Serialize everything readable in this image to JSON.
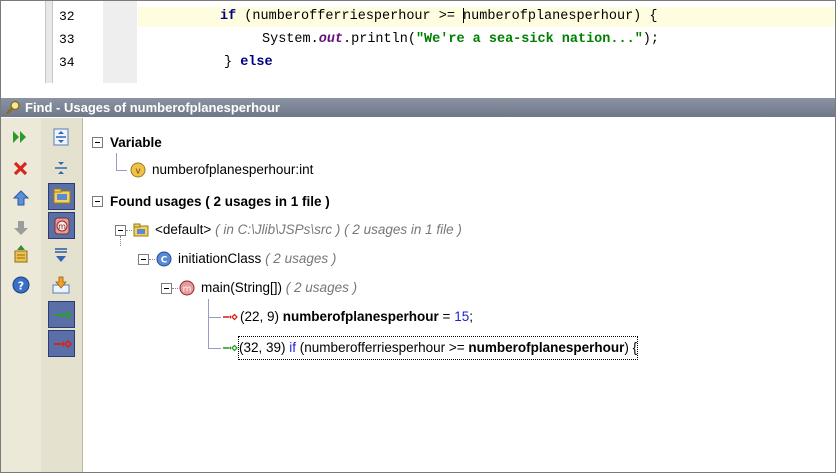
{
  "editor": {
    "lines": [
      {
        "num": "32",
        "kw1": "if",
        "code_a": " (numberofferriesperhour >= ",
        "code_b": "numberofplanesperhour) {"
      },
      {
        "num": "33",
        "prefix": "System.",
        "italic": "out",
        "mid": ".println(",
        "string": "\"We're a sea-sick nation...\"",
        "suffix": ");"
      },
      {
        "num": "34",
        "brace": "} ",
        "kw": "else"
      }
    ]
  },
  "panel": {
    "title": "Find - Usages of numberofplanesperhour"
  },
  "toolbar": {
    "left_icons": [
      "rerun-icon",
      "close-icon",
      "previous-occurrence-icon",
      "next-occurrence-icon",
      "pin-icon",
      "help-icon"
    ],
    "right_icons": [
      "expand-all-icon",
      "collapse-all-icon",
      "group-by-package-icon",
      "group-by-class-icon",
      "autoscroll-icon",
      "export-icon",
      "show-read-access-icon",
      "show-write-access-icon"
    ]
  },
  "tree": {
    "variable_header": "Variable",
    "variable_item": "numberofplanesperhour:int",
    "usages_header": "Found usages ( 2 usages in 1 file )",
    "package": {
      "name": "<default>",
      "detail": "( in C:\\Jlib\\JSPs\\src ) ( 2 usages in 1 file )"
    },
    "class": {
      "name": "initiationClass",
      "detail": "( 2 usages )"
    },
    "method": {
      "name": "main(String[])",
      "detail": "( 2 usages )"
    },
    "usages": [
      {
        "pos": "(22, 9) ",
        "bold": "numberofplanesperhour",
        "op": " = ",
        "num": "15",
        "end": ";"
      },
      {
        "pos": "(32, 39) ",
        "kw": "if",
        "pre": " (numberofferriesperhour >= ",
        "bold": "numberofplanesperhour",
        "end": ") {"
      }
    ]
  },
  "colors": {
    "title_bar": "#7b8494",
    "selected_toggle": "#5a6ea8",
    "keyword": "#000080",
    "string": "#008000",
    "number": "#1f1fd6"
  }
}
